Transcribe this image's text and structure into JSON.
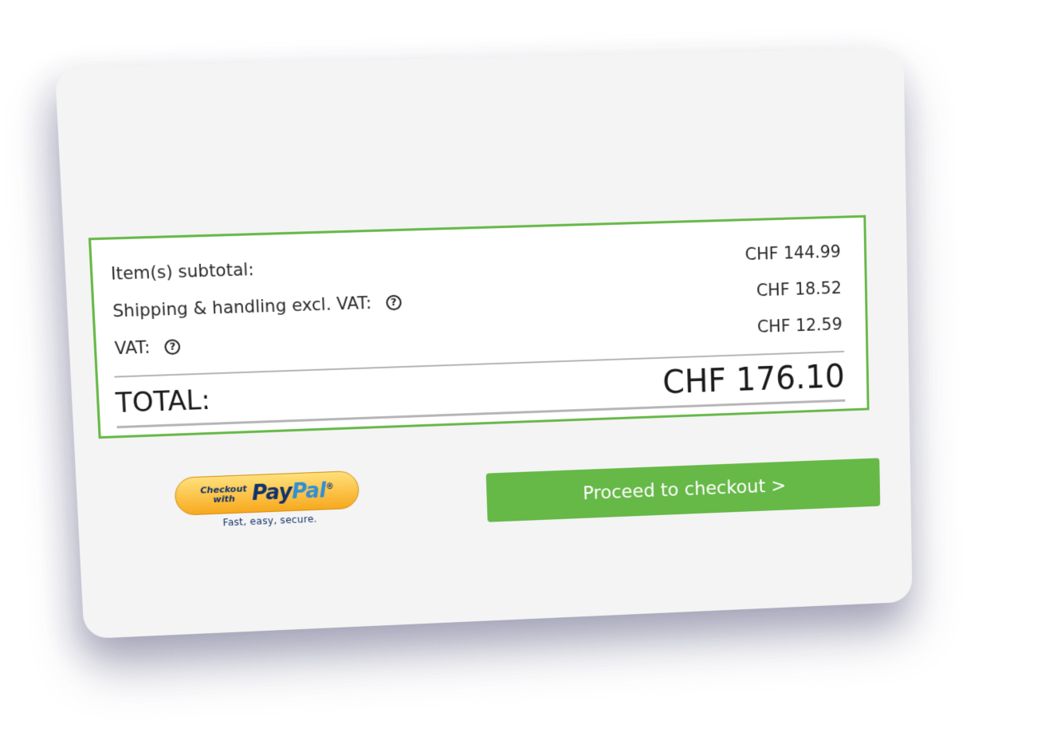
{
  "summary": {
    "subtotal_label": "Item(s) subtotal:",
    "subtotal_value": "CHF 144.99",
    "shipping_label": "Shipping & handling excl. VAT:",
    "shipping_value": "CHF 18.52",
    "vat_label": "VAT:",
    "vat_value": "CHF 12.59",
    "total_label": "TOTAL:",
    "total_value": "CHF 176.10",
    "help_icon": "?"
  },
  "paypal": {
    "small_text_1": "Checkout",
    "small_text_2": "with",
    "brand_pay": "Pay",
    "brand_pal": "Pal",
    "brand_tm": "®",
    "tagline": "Fast, easy, secure."
  },
  "checkout": {
    "label": "Proceed to checkout >"
  },
  "colors": {
    "accent_green": "#66b847",
    "card_bg": "#f4f4f4",
    "paypal_navy": "#12326b",
    "paypal_gold": "#f7a91e"
  },
  "icons": {
    "help": "question-circle-icon"
  }
}
